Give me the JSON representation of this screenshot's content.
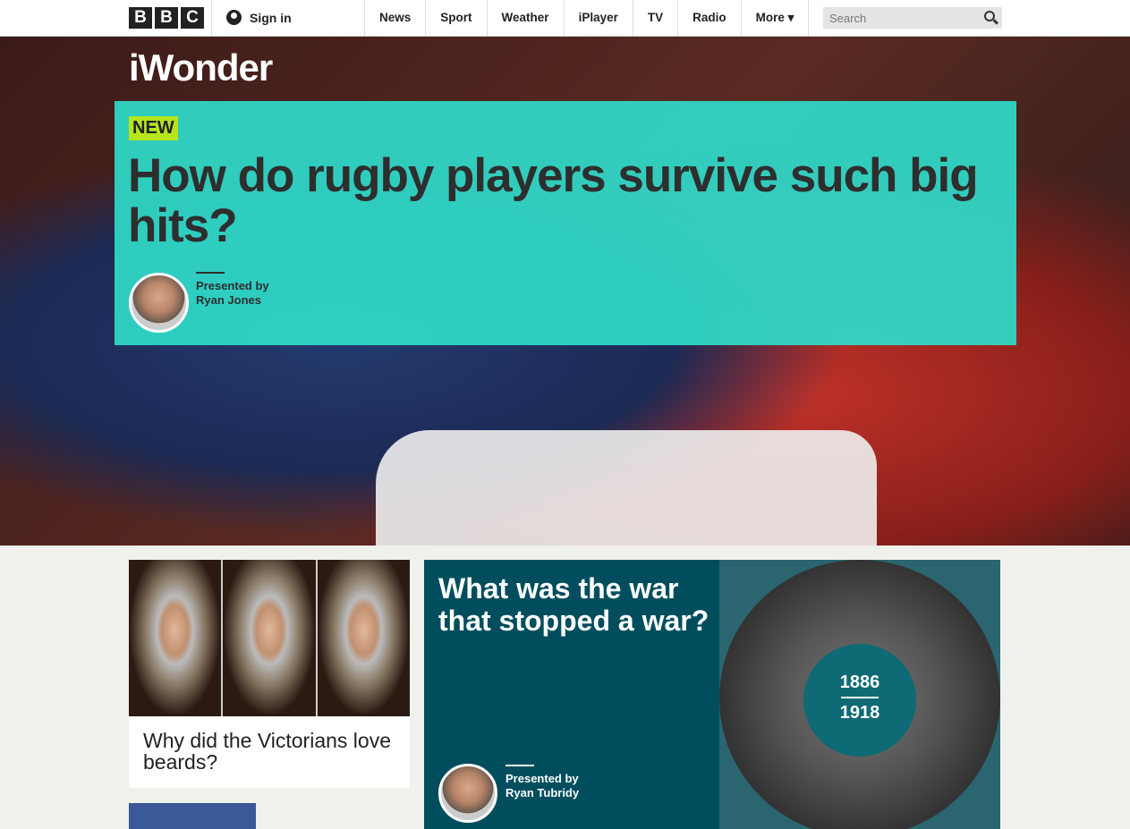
{
  "header": {
    "logo": [
      "B",
      "B",
      "C"
    ],
    "sign_in": "Sign in",
    "nav": [
      "News",
      "Sport",
      "Weather",
      "iPlayer",
      "TV",
      "Radio",
      "More ▾"
    ],
    "search_placeholder": "Search"
  },
  "hero": {
    "brand": "iWonder",
    "badge": "NEW",
    "title": "How do rugby players survive such big hits?",
    "presented_by": "Presented by",
    "presenter": "Ryan Jones",
    "card_color": "#2fd9c8"
  },
  "tiles": [
    {
      "title": "Why did the Victorians love beards?"
    },
    {
      "title": "What was the war that stopped a war?",
      "presented_by": "Presented by",
      "presenter": "Ryan Tubridy",
      "year_start": "1886",
      "year_end": "1918",
      "bg_color": "#004e5d"
    }
  ]
}
